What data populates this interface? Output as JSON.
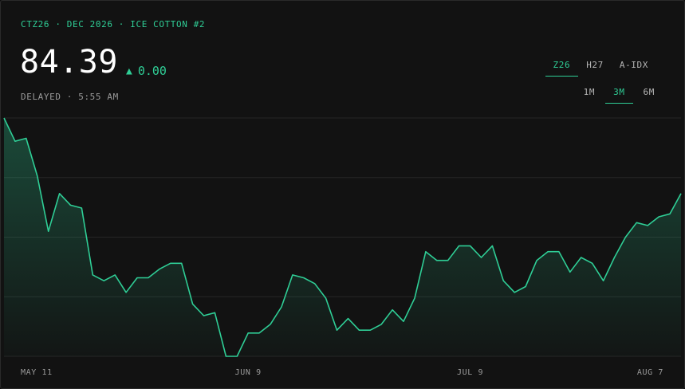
{
  "header": {
    "symbol_parts": [
      "CTZ26",
      "DEC 2026",
      "ICE COTTON #2"
    ],
    "separator": " · ",
    "price": "84.39",
    "change_arrow": "▲",
    "change": "0.00",
    "status": "DELAYED",
    "time": "5:55 AM"
  },
  "contract_tabs": [
    {
      "label": "Z26",
      "active": true
    },
    {
      "label": "H27",
      "active": false
    },
    {
      "label": "A-IDX",
      "active": false
    }
  ],
  "range_tabs": [
    {
      "label": "1M",
      "active": false
    },
    {
      "label": "3M",
      "active": true
    },
    {
      "label": "6M",
      "active": false
    }
  ],
  "colors": {
    "accent": "#2fce96",
    "background": "#121212",
    "grid": "#262626",
    "muted_text": "#9a9a9a"
  },
  "chart_data": {
    "type": "area",
    "title": "",
    "xlabel": "",
    "ylabel": "",
    "grid": "horizontal",
    "x_ticks": [
      {
        "label": "MAY 11",
        "index": 2
      },
      {
        "label": "JUN 9",
        "index": 22
      },
      {
        "label": "JUL 9",
        "index": 42
      },
      {
        "label": "AUG 7",
        "index": 62
      }
    ],
    "series": [
      {
        "values": [
          89.6,
          88.8,
          88.9,
          87.6,
          85.7,
          87.0,
          86.6,
          86.5,
          84.2,
          84.0,
          84.2,
          83.6,
          84.1,
          84.1,
          84.4,
          84.6,
          84.6,
          83.2,
          82.8,
          82.9,
          81.4,
          81.4,
          82.2,
          82.2,
          82.5,
          83.1,
          84.2,
          84.1,
          83.9,
          83.4,
          82.3,
          82.7,
          82.3,
          82.3,
          82.5,
          83.0,
          82.6,
          83.4,
          85.0,
          84.7,
          84.7,
          85.2,
          85.2,
          84.8,
          85.2,
          84.0,
          83.6,
          83.8,
          84.7,
          85.0,
          85.0,
          84.3,
          84.8,
          84.6,
          84.0,
          84.8,
          85.5,
          86.0,
          85.9,
          86.2,
          86.3,
          87.0
        ]
      }
    ],
    "ylim": [
      81.4,
      89.6
    ]
  }
}
